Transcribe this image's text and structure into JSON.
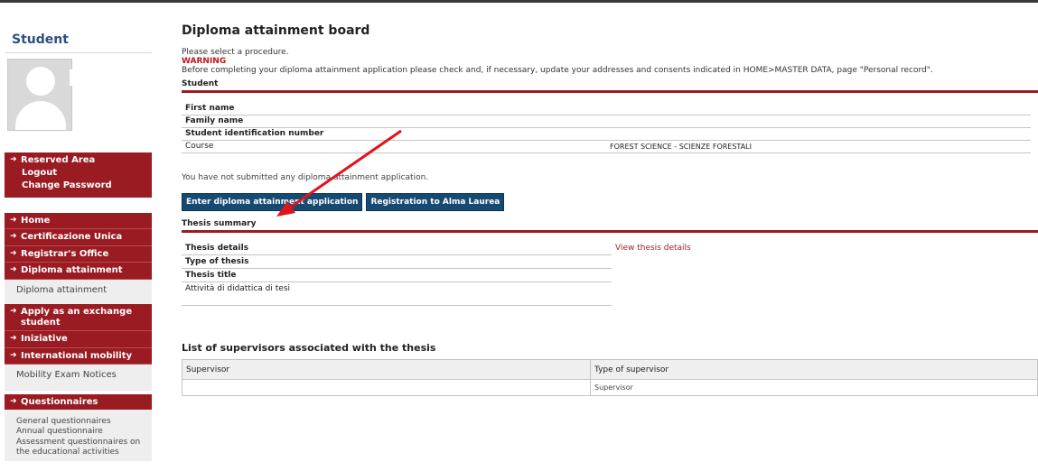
{
  "sidebar": {
    "title": "Student",
    "user_name": "",
    "account_menu": [
      {
        "label": "Reserved Area"
      },
      {
        "label": "Logout"
      },
      {
        "label": "Change Password"
      }
    ],
    "nav": {
      "home": "Home",
      "certificazione": "Certificazione Unica",
      "registrar": "Registrar's Office",
      "diploma": "Diploma attainment",
      "diploma_sub": "Diploma attainment",
      "exchange": "Apply as an exchange student",
      "iniziative": "Iniziative",
      "intl": "International mobility",
      "intl_sub": "Mobility Exam Notices",
      "questionnaires": "Questionnaires",
      "q_sub": [
        "General questionnaires",
        "Annual questionnaire",
        "Assessment questionnaires on the educational activities"
      ]
    }
  },
  "main": {
    "title": "Diploma attainment board",
    "prompt": "Please select a procedure.",
    "warning": "WARNING",
    "warning_text": "Before completing your diploma attainment application please check and, if necessary, update your addresses and consents indicated in HOME>MASTER DATA, page \"Personal record\".",
    "student_section": "Student",
    "student_rows": [
      {
        "label": "First name",
        "value": "",
        "value2": ""
      },
      {
        "label": "Family name",
        "value": "",
        "value2": ""
      },
      {
        "label": "Student identification number",
        "value": "",
        "value2": ""
      },
      {
        "label": "Course",
        "value": "FOREST SCIENCE - SCIENZE FORESTALI",
        "value2": ""
      }
    ],
    "status": "You have not submitted any diploma attainment application.",
    "btn_enter": "Enter diploma attainment application",
    "btn_alma": "Registration to Alma Laurea",
    "thesis_section": "Thesis summary",
    "thesis_rows": [
      {
        "label": "Thesis details",
        "value": "View thesis details"
      },
      {
        "label": "Type of thesis",
        "value": ""
      },
      {
        "label": "Thesis title",
        "value": ""
      },
      {
        "label": "Attività di didattica di tesi",
        "value": ""
      }
    ],
    "supervisors_title": "List of supervisors associated with the thesis",
    "supervisor_headers": [
      "Supervisor",
      "Type of supervisor"
    ],
    "supervisor_rows": [
      {
        "name": "",
        "type": "Supervisor"
      }
    ]
  },
  "colors": {
    "menu_red": "#9a1b22",
    "button_blue": "#164a72",
    "title_blue": "#2e4f82",
    "arrow_red": "#e0141c"
  }
}
